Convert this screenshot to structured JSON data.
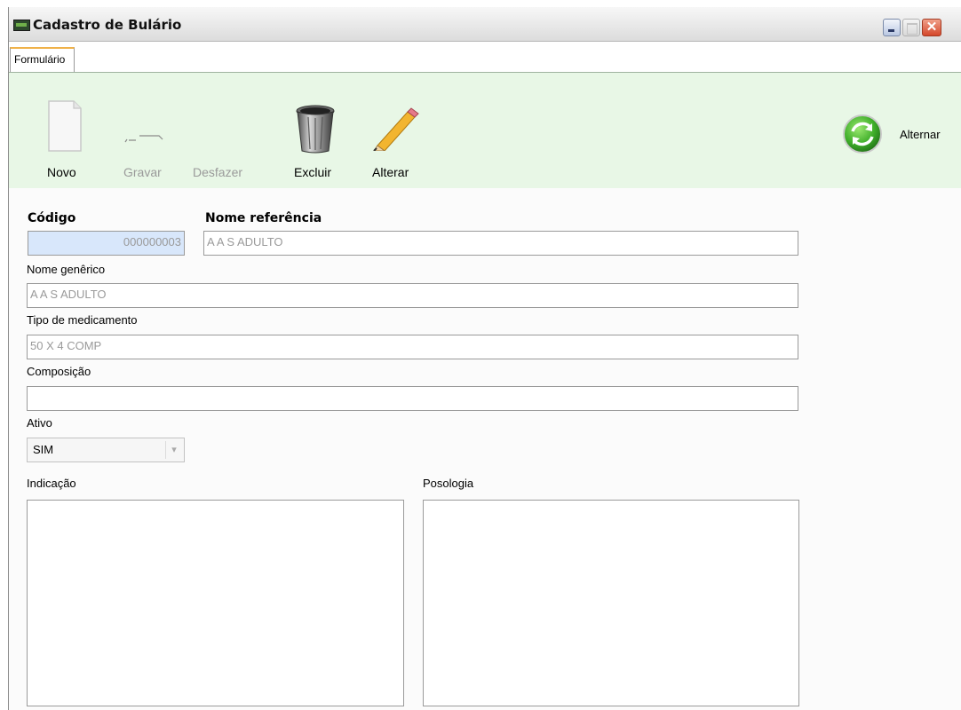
{
  "window": {
    "title": "Cadastro de Bulário",
    "close_glyph": "✕"
  },
  "tabs": [
    {
      "label": "Formulário",
      "active": true
    }
  ],
  "toolbar": {
    "novo_label": "Novo",
    "gravar_label": "Gravar",
    "desfazer_label": "Desfazer",
    "excluir_label": "Excluir",
    "alterar_label": "Alterar",
    "alternar_label": "Alternar",
    "colors": {
      "background": "#e8f7e6",
      "disabled_text": "#9a9a9a",
      "alternar_green": "#3fae2a"
    }
  },
  "form": {
    "codigo": {
      "label": "Código",
      "value": "000000003"
    },
    "nome_referencia": {
      "label": "Nome referência",
      "value": "A A S ADULTO"
    },
    "nome_generico": {
      "label": "Nome genêrico",
      "value": "A A S ADULTO"
    },
    "tipo_medicamento": {
      "label": "Tipo de medicamento",
      "value": "50 X 4 COMP"
    },
    "composicao": {
      "label": "Composição",
      "value": ""
    },
    "ativo": {
      "label": "Ativo",
      "value": "SIM"
    },
    "indicacao": {
      "label": "Indicação",
      "value": ""
    },
    "posologia": {
      "label": "Posologia",
      "value": ""
    }
  }
}
